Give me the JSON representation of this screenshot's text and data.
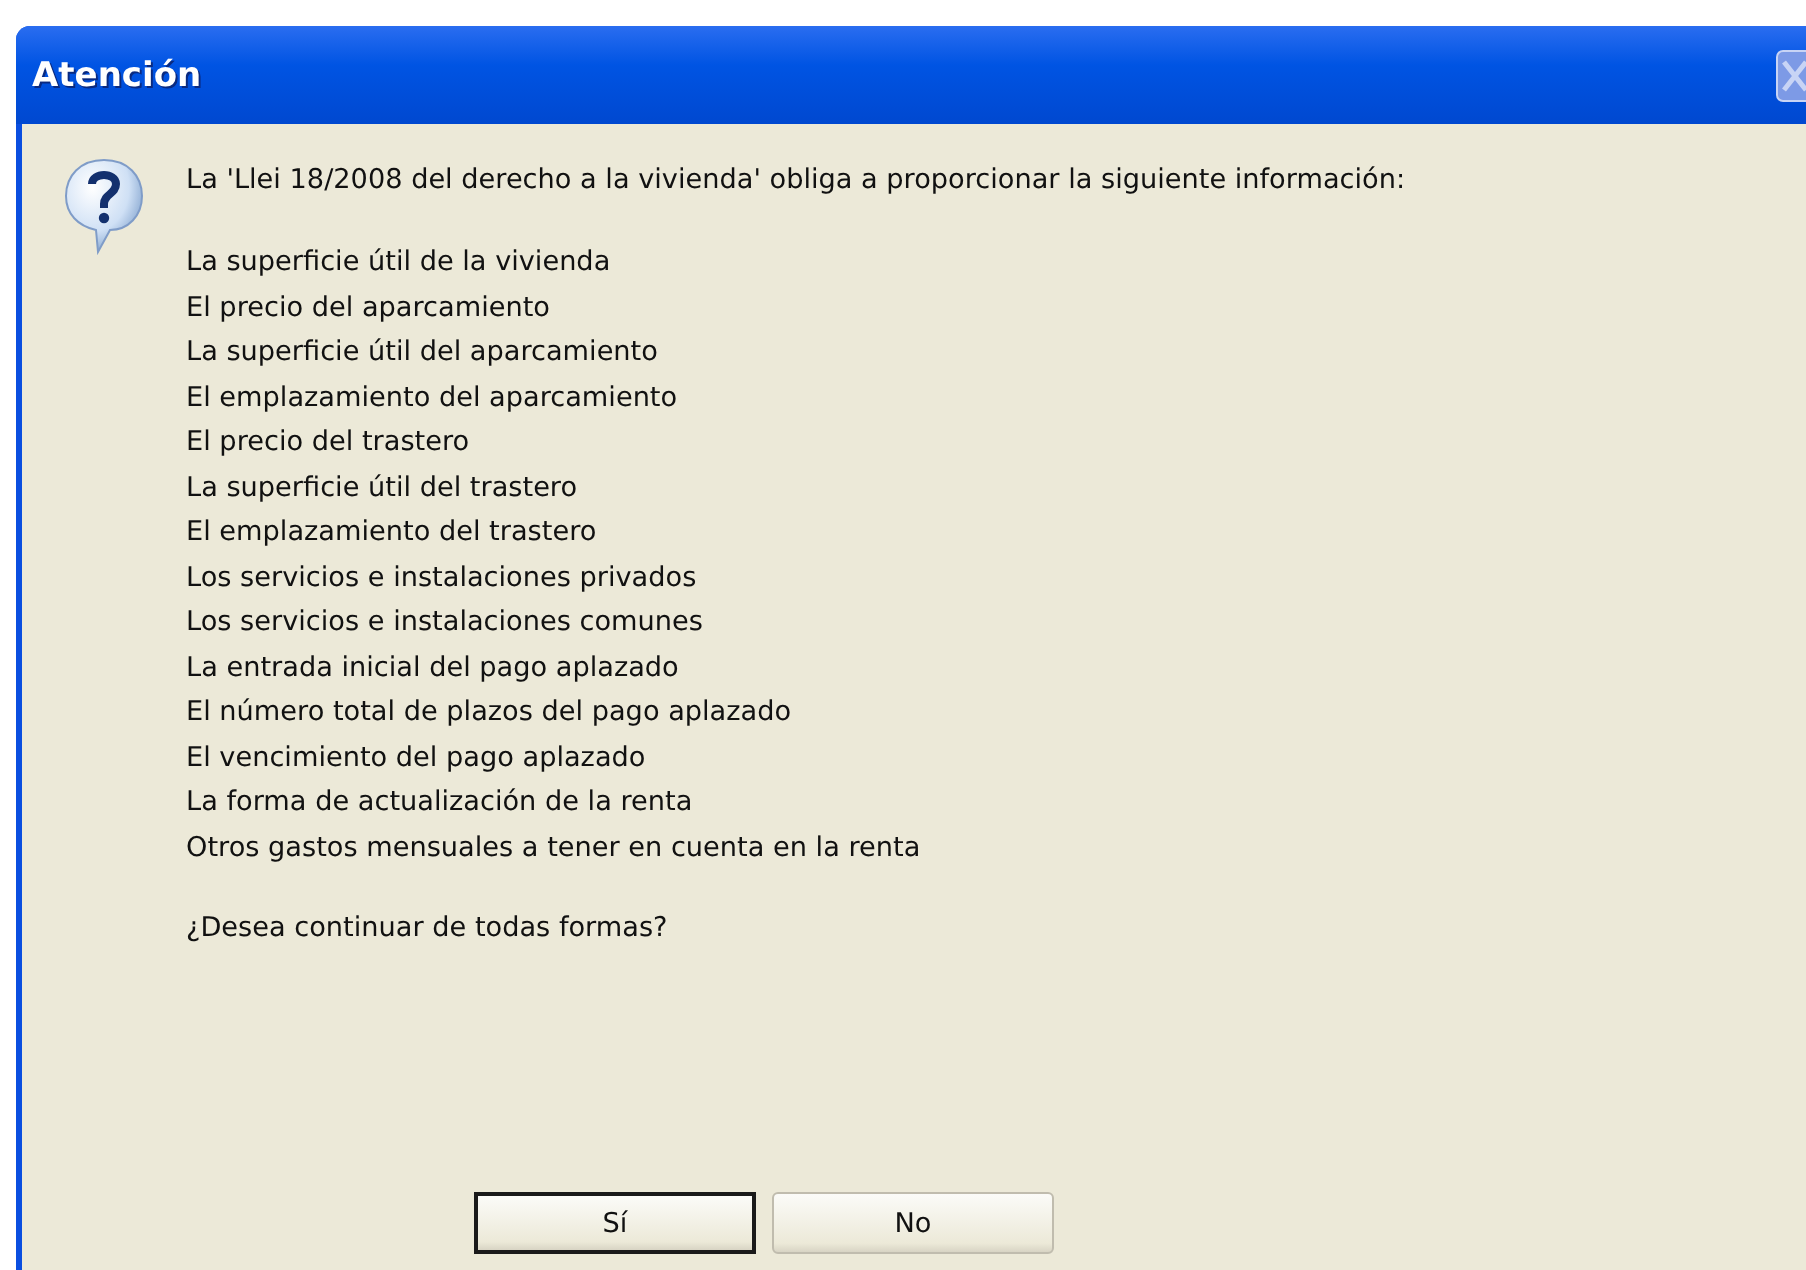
{
  "window": {
    "title": "Atención"
  },
  "message": {
    "intro": "La 'Llei 18/2008 del derecho a la vivienda' obliga a proporcionar la siguiente información:",
    "items": [
      "La superficie útil de la vivienda",
      "El precio del aparcamiento",
      "La superficie útil del aparcamiento",
      "El emplazamiento del aparcamiento",
      "El precio del trastero",
      "La superficie útil del trastero",
      "El emplazamiento del trastero",
      "Los servicios e instalaciones privados",
      "Los servicios e instalaciones comunes",
      "La entrada inicial del pago aplazado",
      "El número total de plazos del pago aplazado",
      "El vencimiento del pago aplazado",
      "La forma de actualización de la renta",
      "Otros gastos mensuales a tener en cuenta en la renta"
    ],
    "question": "¿Desea continuar de todas formas?"
  },
  "buttons": [
    {
      "label": "Sí",
      "default": true
    },
    {
      "label": "No",
      "default": false
    }
  ]
}
